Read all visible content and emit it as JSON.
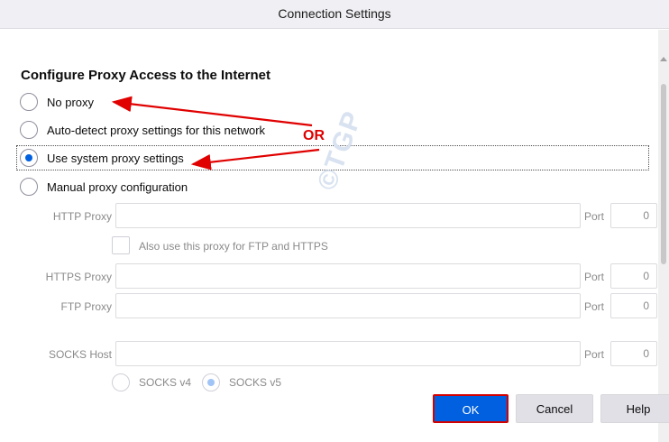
{
  "window": {
    "title": "Connection Settings"
  },
  "section": {
    "heading": "Configure Proxy Access to the Internet"
  },
  "proxy_options": [
    {
      "label": "No proxy",
      "checked": false
    },
    {
      "label": "Auto-detect proxy settings for this network",
      "checked": false
    },
    {
      "label": "Use system proxy settings",
      "checked": true
    },
    {
      "label": "Manual proxy configuration",
      "checked": false
    }
  ],
  "manual": {
    "http_label": "HTTP Proxy",
    "http_value": "",
    "http_port_label": "Port",
    "http_port": "0",
    "also_use_label": "Also use this proxy for FTP and HTTPS",
    "https_label": "HTTPS Proxy",
    "https_value": "",
    "https_port_label": "Port",
    "https_port": "0",
    "ftp_label": "FTP Proxy",
    "ftp_value": "",
    "ftp_port_label": "Port",
    "ftp_port": "0",
    "socks_label": "SOCKS Host",
    "socks_value": "",
    "socks_port_label": "Port",
    "socks_port": "0",
    "socks_v4_label": "SOCKS v4",
    "socks_v5_label": "SOCKS v5",
    "socks_version_selected": "SOCKS v5"
  },
  "buttons": {
    "ok": "OK",
    "cancel": "Cancel",
    "help": "Help"
  },
  "annotation": {
    "or_text": "OR",
    "arrow_color": "#e00000",
    "ok_highlight_color": "#d40000"
  },
  "watermark": {
    "text": "©TGP"
  },
  "colors": {
    "accent": "#0060df"
  }
}
